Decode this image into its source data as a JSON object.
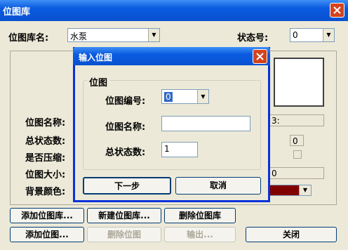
{
  "main_window": {
    "title": "位图库",
    "library_name_label": "位图库名:",
    "library_name_value": "水泵",
    "state_number_label": "状态号:",
    "state_number_value": "0",
    "bitmap_name_label": "位图名称:",
    "bitmap_name_value": "3:",
    "total_states_label": "总状态数:",
    "total_states_value": "0",
    "compressed_label": "是否压缩:",
    "bitmap_size_label": "位图大小:",
    "bitmap_size_value": "0",
    "bg_color_label": "背景颜色:",
    "bg_color": "#800000",
    "buttons": {
      "add_library": "添加位图库...",
      "new_library": "新建位图库...",
      "delete_library": "删除位图库",
      "add_bitmap": "添加位图...",
      "delete_bitmap": "删除位图",
      "export": "输出...",
      "close": "关闭"
    }
  },
  "dialog": {
    "title": "输入位图",
    "group_label": "位图",
    "bitmap_number_label": "位图编号:",
    "bitmap_number_value": "0",
    "bitmap_name_label": "位图名称:",
    "bitmap_name_value": "",
    "total_states_label": "总状态数:",
    "total_states_value": "1",
    "next_button": "下一步",
    "cancel_button": "取消"
  },
  "colors": {
    "titlebar": "#0a5ae0",
    "dialog_border": "#0831d9",
    "close_button": "#d4431e"
  }
}
